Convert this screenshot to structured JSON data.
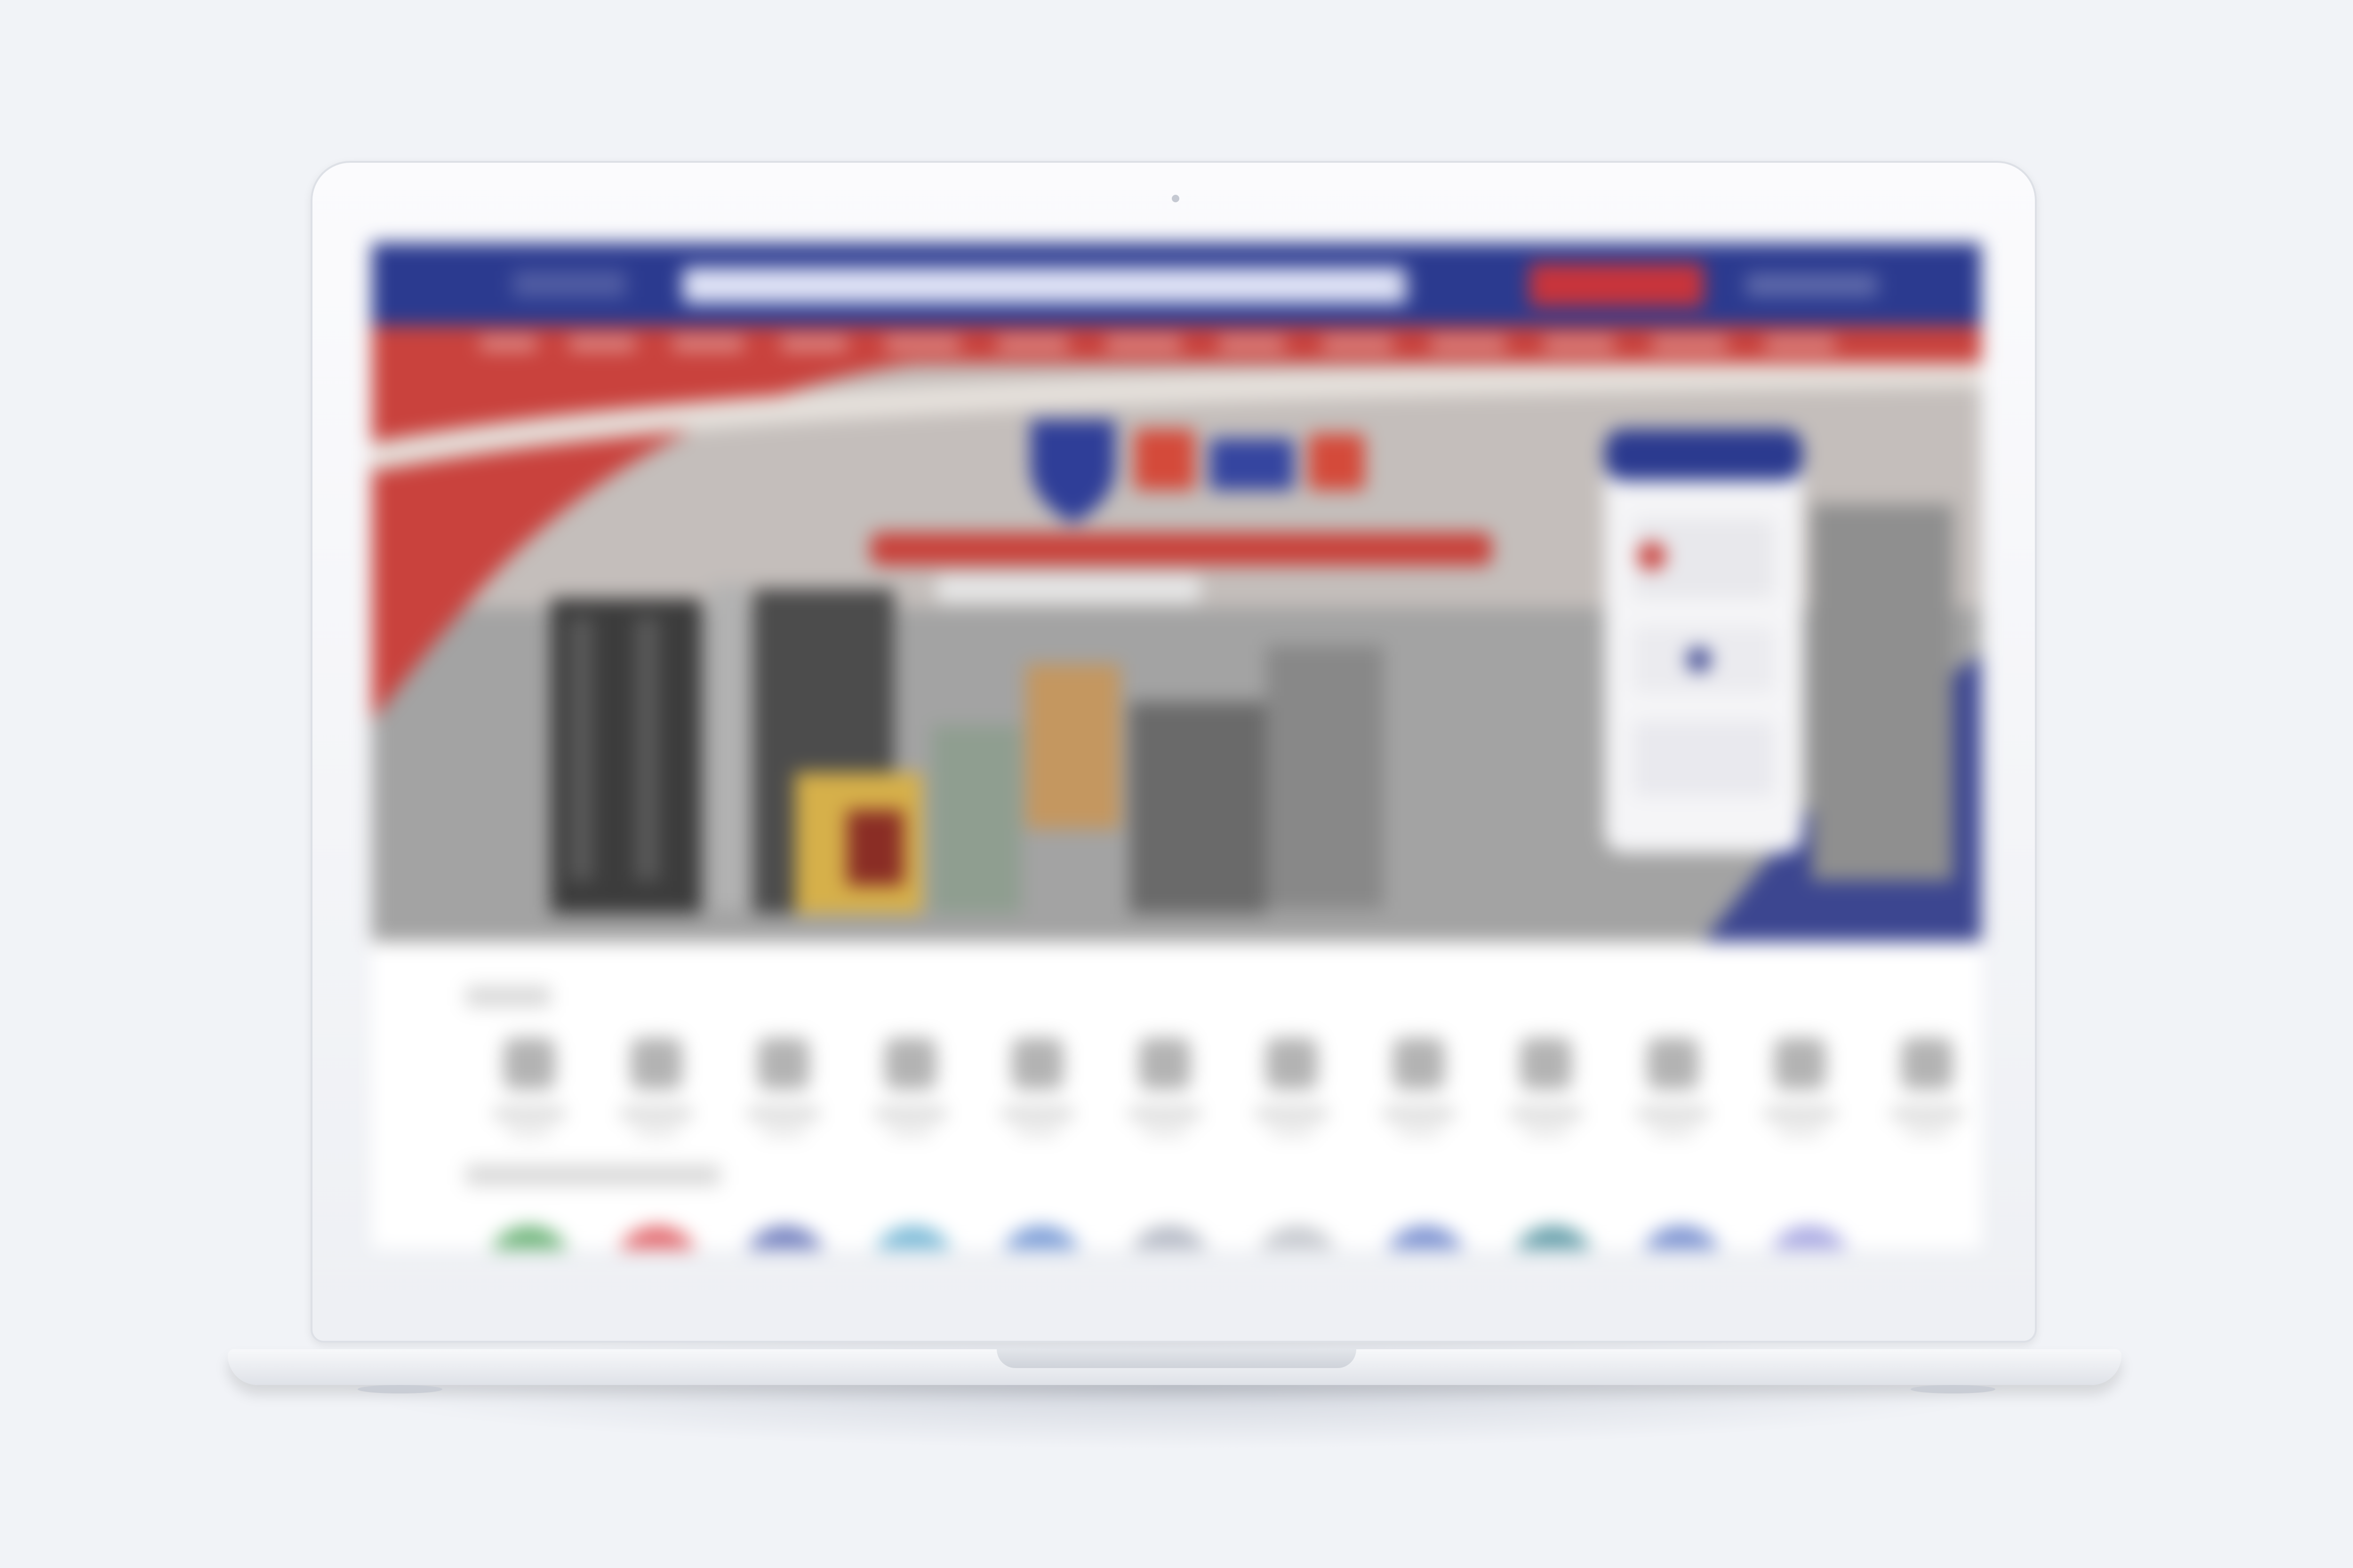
{
  "header": {
    "logo_text": "",
    "search": {
      "value": "",
      "placeholder": ""
    },
    "cta_label": "",
    "account_label": ""
  },
  "hero": {
    "title": "",
    "colors": {
      "red": "#c9423d",
      "blue": "#2b3a8f",
      "gray": "#9b9b9b"
    }
  },
  "categories": {
    "title": "",
    "items": [
      {
        "icon": "product-icon-1",
        "label": ""
      },
      {
        "icon": "product-icon-2",
        "label": ""
      },
      {
        "icon": "product-icon-3",
        "label": ""
      },
      {
        "icon": "product-icon-4",
        "label": ""
      },
      {
        "icon": "product-icon-5",
        "label": ""
      },
      {
        "icon": "product-icon-6",
        "label": ""
      },
      {
        "icon": "product-icon-7",
        "label": ""
      },
      {
        "icon": "product-icon-8",
        "label": ""
      },
      {
        "icon": "product-icon-9",
        "label": ""
      },
      {
        "icon": "product-icon-10",
        "label": ""
      },
      {
        "icon": "product-icon-11",
        "label": ""
      },
      {
        "icon": "product-icon-12",
        "label": ""
      }
    ]
  },
  "brands": {
    "title": "",
    "colors": [
      "#3a9a4a",
      "#d8343b",
      "#3f51a8",
      "#4aa0c8",
      "#4a78c8",
      "#9aa0b0",
      "#b0b4bc",
      "#4a68c0",
      "#2a7a8a",
      "#4a6ac0",
      "#8a8ad8"
    ]
  }
}
